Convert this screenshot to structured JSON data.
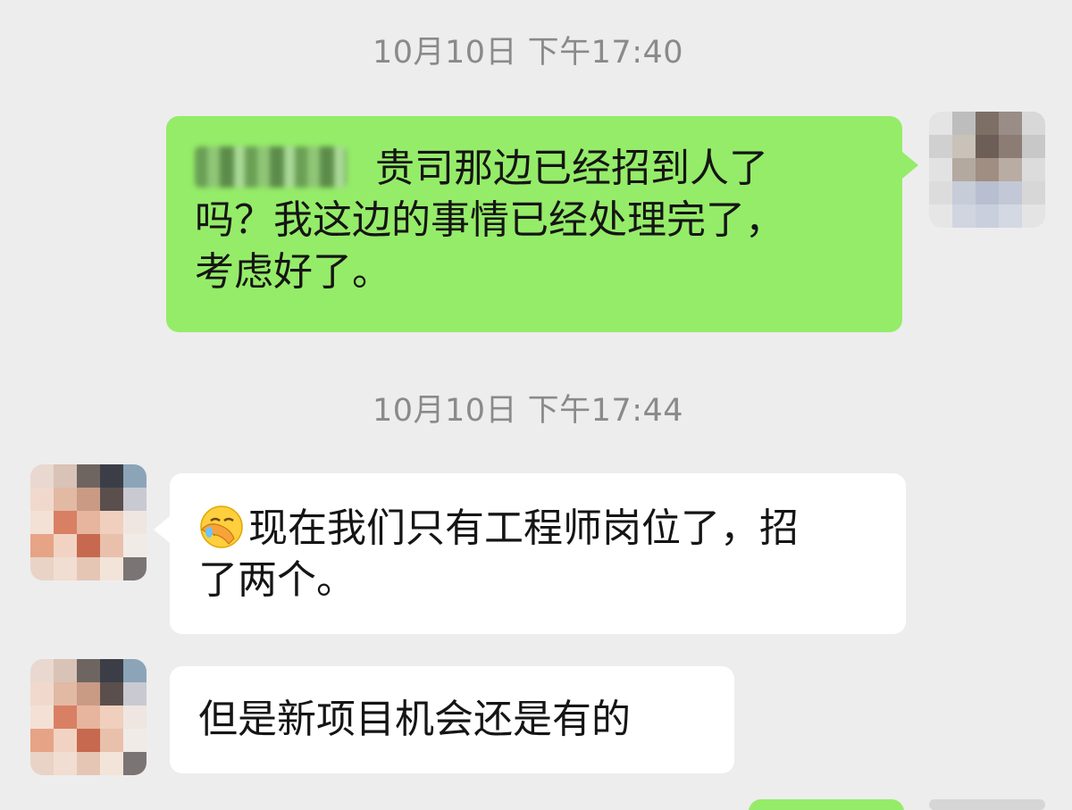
{
  "chat": {
    "timestamps": [
      "10月10日 下午17:40",
      "10月10日 下午17:44"
    ],
    "messages": [
      {
        "from": "me",
        "lines": [
          "贵司那边已经招到人了",
          "吗？我这边的事情已经处理完了，",
          "考虑好了。"
        ],
        "has_redacted_name": true
      },
      {
        "from": "other",
        "emoji": "face-palm-emoji",
        "lines": [
          "现在我们只有工程师岗位了，招",
          "了两个。"
        ]
      },
      {
        "from": "other",
        "lines": [
          "但是新项目机会还是有的"
        ]
      }
    ]
  },
  "colors": {
    "background": "#ededed",
    "sent_bubble": "#95ec69",
    "received_bubble": "#ffffff",
    "timestamp_text": "#8a8a8a"
  }
}
